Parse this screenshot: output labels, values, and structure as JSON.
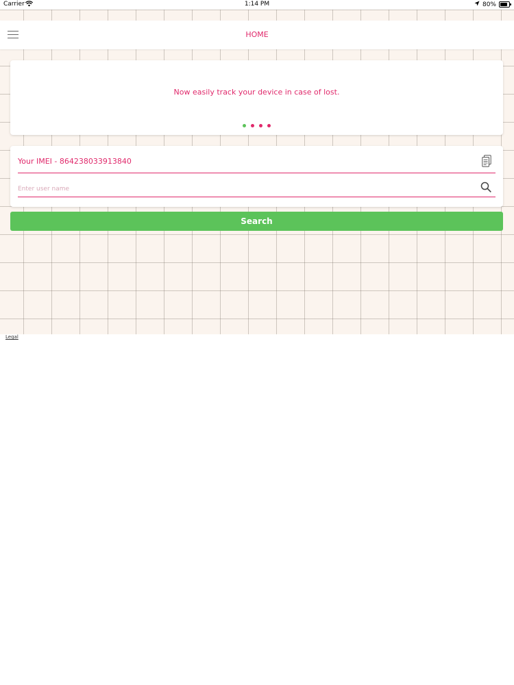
{
  "status_bar": {
    "carrier": "Carrier",
    "time": "1:14 PM",
    "battery": "80%",
    "battery_level": 0.8,
    "icons": [
      "wifi-icon",
      "location-arrow-icon",
      "battery-icon"
    ]
  },
  "nav": {
    "title": "HOME",
    "menu_icon": "hamburger-menu-icon"
  },
  "banner": {
    "text": "Now easily track your device in case of lost.",
    "page_count": 4,
    "active_page": 1
  },
  "form": {
    "imei_label": "Your IMEI - 864238033913840",
    "copy_icon": "clipboard-icon",
    "username_value": "",
    "username_placeholder": "Enter user name",
    "search_icon": "search-icon"
  },
  "search_button": {
    "label": "Search"
  },
  "map": {
    "legal_link": "Legal"
  },
  "colors": {
    "accent": "#e0296b",
    "button": "#5cc35a",
    "map_background": "#fbf4ee"
  }
}
